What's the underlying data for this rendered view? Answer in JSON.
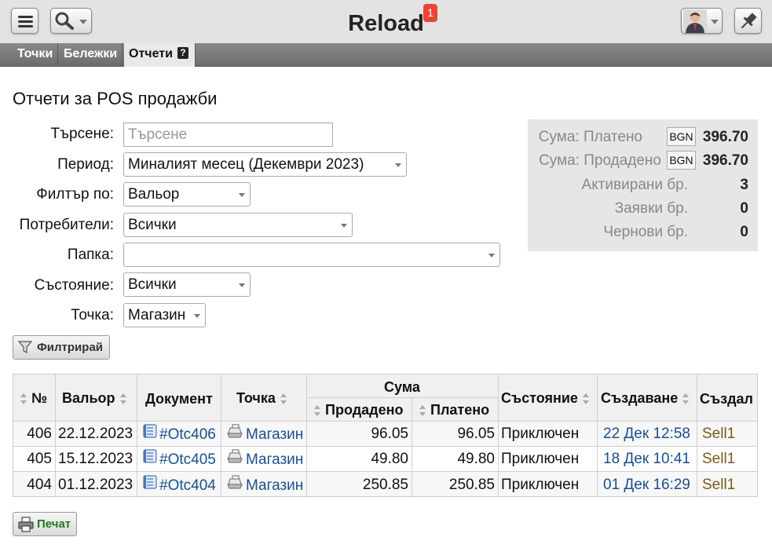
{
  "header": {
    "title": "Reload",
    "notification_count": "1"
  },
  "tabs": [
    {
      "label": "Точки"
    },
    {
      "label": "Бележки"
    },
    {
      "label": "Отчети",
      "help": "?"
    }
  ],
  "page_title": "Отчети за POS продажби",
  "form": {
    "search_label": "Търсене:",
    "search_placeholder": "Търсене",
    "period_label": "Период:",
    "period_value": "Миналият месец (Декември 2023)",
    "filter_label": "Филтър по:",
    "filter_value": "Вальор",
    "users_label": "Потребители:",
    "users_value": "Всички",
    "folder_label": "Папка:",
    "folder_value": "",
    "state_label": "Състояние:",
    "state_value": "Всички",
    "point_label": "Точка:",
    "point_value": "Магазин",
    "filter_button": "Филтрирай"
  },
  "summary": {
    "paid_label": "Сума: Платено",
    "paid_currency": "BGN",
    "paid_value": "396.70",
    "sold_label": "Сума: Продадено",
    "sold_currency": "BGN",
    "sold_value": "396.70",
    "activated_label": "Активирани бр.",
    "activated_value": "3",
    "requests_label": "Заявки бр.",
    "requests_value": "0",
    "drafts_label": "Чернови бр.",
    "drafts_value": "0"
  },
  "table": {
    "headers": {
      "num": "№",
      "valor": "Вальор",
      "document": "Документ",
      "point": "Точка",
      "amount": "Сума",
      "sold": "Продадено",
      "paid": "Платено",
      "state": "Състояние",
      "created": "Създаване",
      "created_by": "Създал"
    },
    "rows": [
      {
        "num": "406",
        "valor": "22.12.2023",
        "document": "#Otc406",
        "point": "Магазин",
        "sold": "96.05",
        "paid": "96.05",
        "state": "Приключен",
        "created": "22 Дек 12:58",
        "created_by": "Sell1"
      },
      {
        "num": "405",
        "valor": "15.12.2023",
        "document": "#Otc405",
        "point": "Магазин",
        "sold": "49.80",
        "paid": "49.80",
        "state": "Приключен",
        "created": "18 Дек 10:41",
        "created_by": "Sell1"
      },
      {
        "num": "404",
        "valor": "01.12.2023",
        "document": "#Otc404",
        "point": "Магазин",
        "sold": "250.85",
        "paid": "250.85",
        "state": "Приключен",
        "created": "01 Дек 16:29",
        "created_by": "Sell1"
      }
    ]
  },
  "print_button": "Печат"
}
